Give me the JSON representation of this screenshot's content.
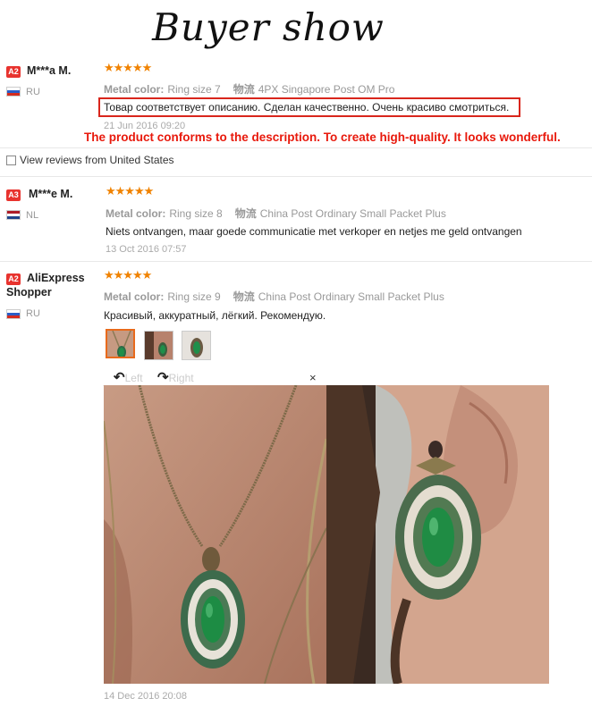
{
  "page_title": "Buyer show",
  "reviews": [
    {
      "badge": "A2",
      "name": "M***a M.",
      "country": "RU",
      "stars": "★★★★★",
      "metal_label": "Metal color:",
      "metal_value": "Ring size 7",
      "shipping_label": "物流",
      "shipping_value": "4PX Singapore Post OM Pro",
      "text": "Товар соответствует описанию. Сделан качественно. Очень красиво смотриться.",
      "date": "21 Jun 2016 09:20"
    },
    {
      "badge": "A3",
      "name": "M***e M.",
      "country": "NL",
      "stars": "★★★★★",
      "metal_label": "Metal color:",
      "metal_value": "Ring size 8",
      "shipping_label": "物流",
      "shipping_value": "China Post Ordinary Small Packet Plus",
      "text": "Niets ontvangen, maar goede communicatie met verkoper en netjes me geld ontvangen",
      "date": "13 Oct 2016 07:57"
    },
    {
      "badge": "A2",
      "name": "AliExpress Shopper",
      "country": "RU",
      "stars": "★★★★★",
      "metal_label": "Metal color:",
      "metal_value": "Ring size 9",
      "shipping_label": "物流",
      "shipping_value": "China Post Ordinary Small Packet Plus",
      "text": "Красивый, аккуратный, лёгкий. Рекомендую.",
      "date": "14 Dec 2016 20:08"
    }
  ],
  "translation": "The product conforms to the description. To create high-quality. It looks wonderful.",
  "filter_label": "View reviews from United States",
  "viewer": {
    "left_label": "Left",
    "right_label": "Right",
    "close_label": "×",
    "rotate_left_icon": "↶",
    "rotate_right_icon": "↷"
  },
  "colors": {
    "star": "#f08200",
    "badge": "#e8332e",
    "highlight": "#d9261c",
    "translation": "#e8190c"
  }
}
